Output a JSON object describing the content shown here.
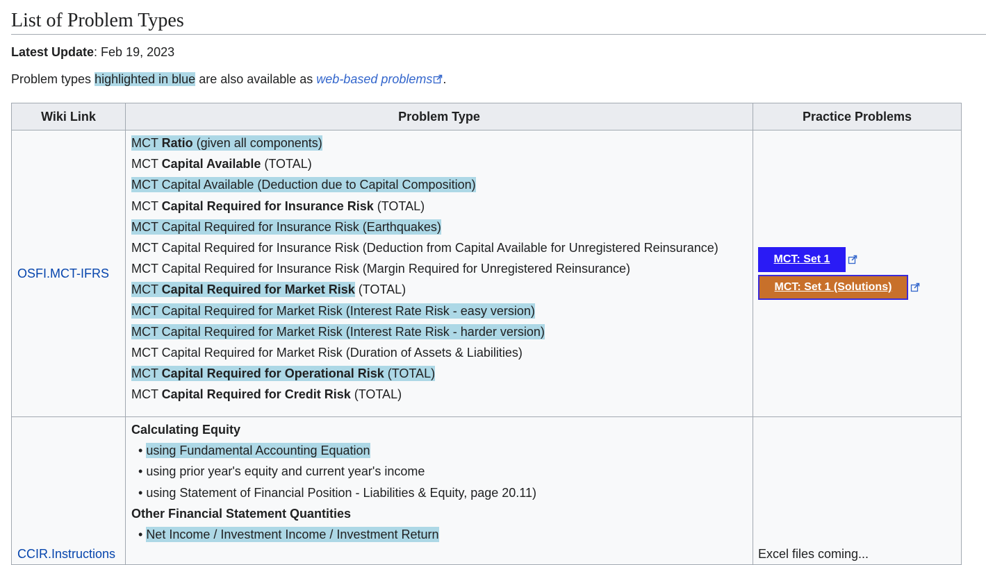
{
  "heading": "List of Problem Types",
  "update": {
    "label": "Latest Update",
    "sep": ": ",
    "date": "Feb 19, 2023"
  },
  "intro": {
    "before": "Problem types ",
    "highlight": "highlighted in blue",
    "middle": " are also available as ",
    "link": "web-based problems",
    "after": "."
  },
  "table": {
    "headers": [
      "Wiki Link",
      "Problem Type",
      "Practice Problems"
    ],
    "row1": {
      "wiki": "OSFI.MCT-IFRS",
      "lines": [
        {
          "hl": true,
          "a": "MCT ",
          "b": "Ratio",
          "c": " (given all components)"
        },
        {
          "hl": false,
          "a": "MCT ",
          "b": "Capital Available",
          "c": " (TOTAL)"
        },
        {
          "hl": true,
          "a": "MCT Capital Available (Deduction due to Capital Composition)",
          "b": "",
          "c": ""
        },
        {
          "hl": false,
          "a": "MCT ",
          "b": "Capital Required for Insurance Risk",
          "c": " (TOTAL)"
        },
        {
          "hl": true,
          "a": "MCT Capital Required for Insurance Risk (Earthquakes)",
          "b": "",
          "c": ""
        },
        {
          "hl": false,
          "a": "MCT Capital Required for Insurance Risk (Deduction from Capital Available for Unregistered Reinsurance)",
          "b": "",
          "c": ""
        },
        {
          "hl": false,
          "a": "MCT Capital Required for Insurance Risk (Margin Required for Unregistered Reinsurance)",
          "b": "",
          "c": ""
        },
        {
          "hl": "partial",
          "a": "MCT ",
          "b": "Capital Required for Market Risk",
          "c": " (TOTAL)"
        },
        {
          "hl": true,
          "a": "MCT Capital Required for Market Risk (Interest Rate Risk - easy version)",
          "b": "",
          "c": ""
        },
        {
          "hl": true,
          "a": "MCT Capital Required for Market Risk (Interest Rate Risk - harder version)",
          "b": "",
          "c": ""
        },
        {
          "hl": false,
          "a": "MCT Capital Required for Market Risk (Duration of Assets & Liabilities)",
          "b": "",
          "c": ""
        },
        {
          "hl": true,
          "a": "MCT ",
          "b": "Capital Required for Operational Risk",
          "c": " (TOTAL)"
        },
        {
          "hl": false,
          "a": "MCT ",
          "b": "Capital Required for Credit Risk",
          "c": " (TOTAL)"
        }
      ],
      "buttons": [
        {
          "label": "MCT: Set 1",
          "color": "#2a1bf5"
        },
        {
          "label": "MCT: Set 1 (Solutions)",
          "color": "#c8702a"
        }
      ]
    },
    "row2": {
      "wiki": "CCIR.Instructions",
      "section1": "Calculating Equity",
      "items1": [
        {
          "hl": true,
          "text": "using Fundamental Accounting Equation"
        },
        {
          "hl": false,
          "text": "using prior year's equity and current year's income"
        },
        {
          "hl": false,
          "text": "using Statement of Financial Position - Liabilities & Equity, page 20.11)"
        }
      ],
      "section2": "Other Financial Statement Quantities",
      "items2": [
        {
          "hl": true,
          "text": "Net Income / Investment Income / Investment Return"
        }
      ],
      "practice": "Excel files coming..."
    }
  },
  "colors": {
    "highlight": "#add8e6",
    "link": "#0645ad",
    "ext_link": "#3366cc"
  }
}
